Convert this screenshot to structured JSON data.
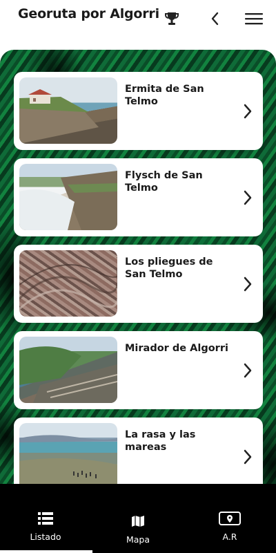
{
  "header": {
    "title": "Georuta por Algorri",
    "icons": [
      "trophy-icon",
      "back-chevron-icon",
      "hamburger-menu-icon"
    ]
  },
  "list": {
    "items": [
      {
        "title": "Ermita de San Telmo",
        "image": "coastal-chapel-cliff"
      },
      {
        "title": "Flysch de San Telmo",
        "image": "cliff-beach-waves"
      },
      {
        "title": "Los pliegues de San Telmo",
        "image": "folded-rock-layers"
      },
      {
        "title": "Mirador de Algorri",
        "image": "coastal-viewpoint-flysch"
      },
      {
        "title": "La rasa y las mareas",
        "image": "tidal-platform-coast"
      }
    ]
  },
  "bottom_nav": {
    "listado": "Listado",
    "mapa": "Mapa",
    "ar": "A.R",
    "active": "Listado"
  },
  "colors": {
    "background_green": "#0b5a2f",
    "card": "#ffffff",
    "nav": "#000000"
  }
}
